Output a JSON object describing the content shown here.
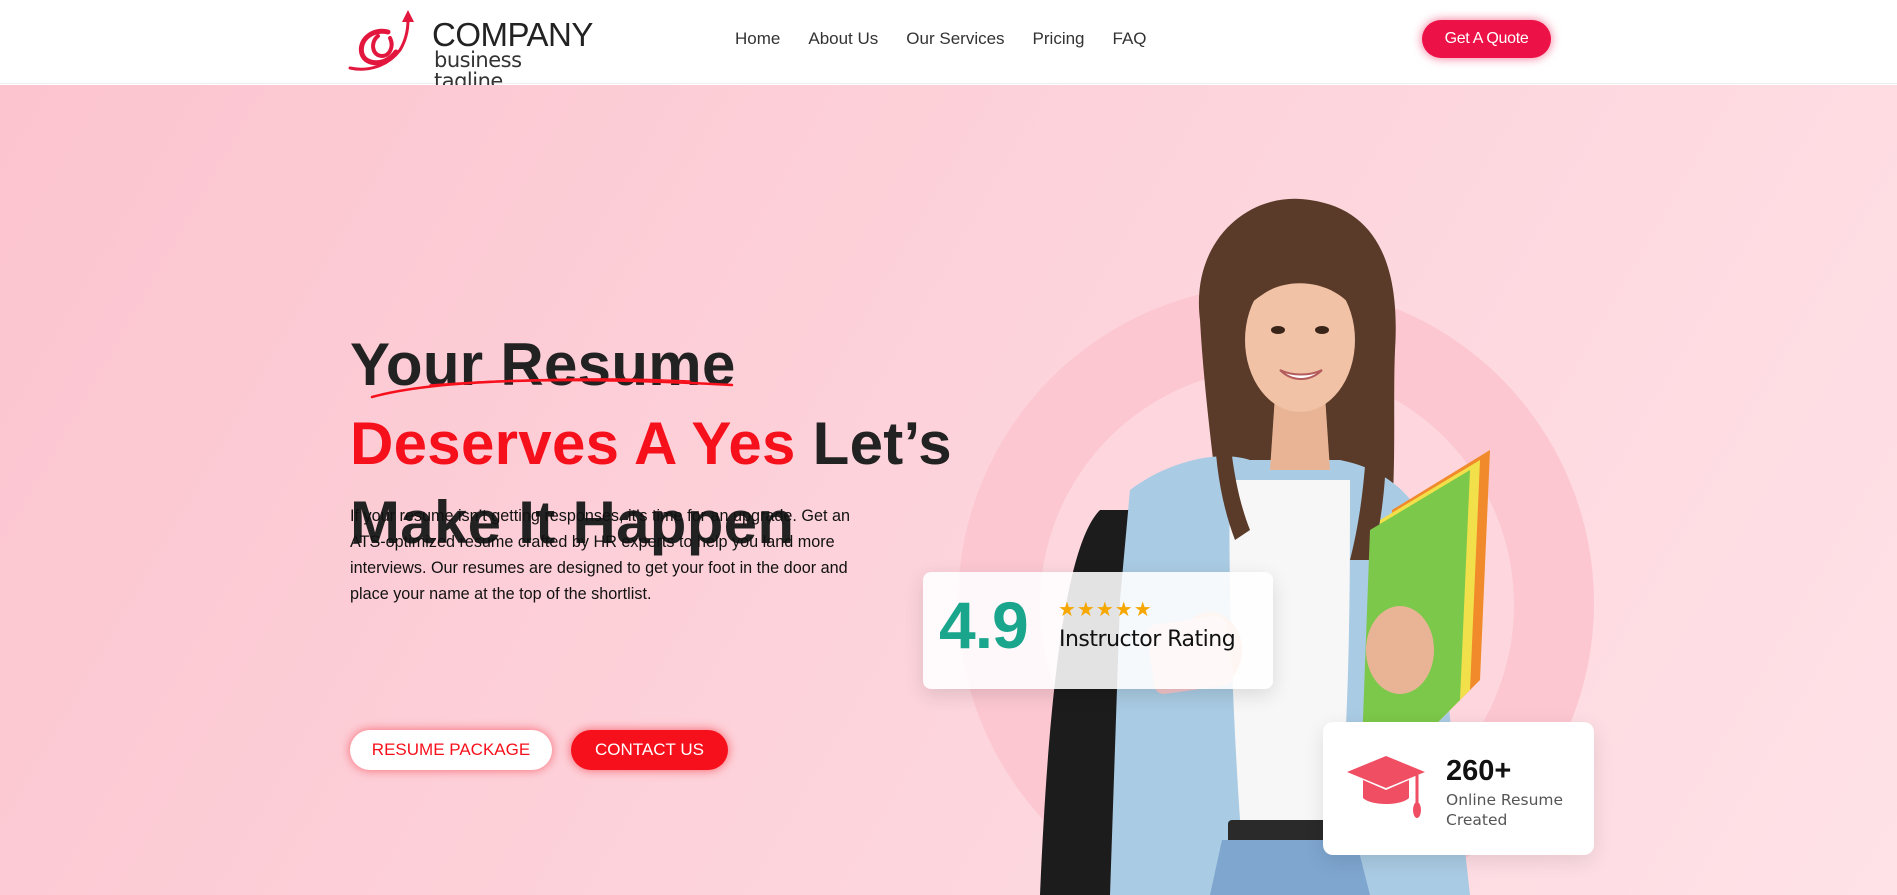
{
  "header": {
    "logo": {
      "company": "COMPANY",
      "tagline": "business tagline"
    },
    "nav": [
      "Home",
      "About Us",
      "Our Services",
      "Pricing",
      "FAQ"
    ],
    "quote_button": "Get A Quote"
  },
  "hero": {
    "headline": {
      "line1": "Your Resume",
      "highlight": "Deserves A Yes",
      "line2_rest": " Let’s",
      "line3": "Make It Happen"
    },
    "description": "If your resume isn’t getting responses, it’s time for an upgrade. Get an ATS-optimized resume crafted by HR experts to help you land more interviews. Our resumes are designed to get your foot in the door and place your name at the top of the shortlist.",
    "buttons": {
      "resume_package": "RESUME PACKAGE",
      "contact_us": "CONTACT US"
    }
  },
  "rating_card": {
    "value": "4.9",
    "stars": "★★★★★",
    "label": "Instructor Rating"
  },
  "resume_card": {
    "count": "260+",
    "label": " Online Resume Created",
    "icon": "graduation-cap-icon"
  },
  "colors": {
    "accent": "#ec1247",
    "headline_red": "#f5101c",
    "rating_green": "#1aa58d",
    "star": "#f6a700"
  }
}
